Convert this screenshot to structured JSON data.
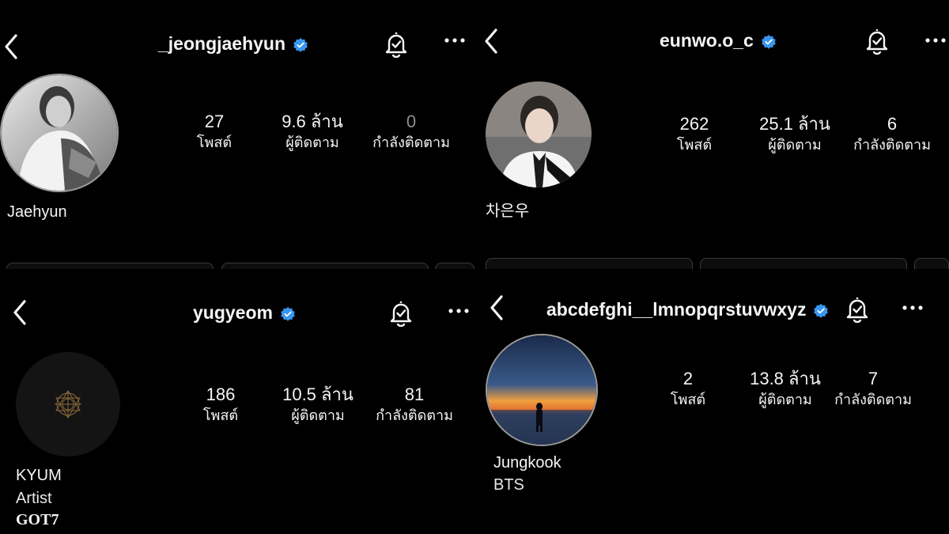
{
  "profiles": [
    {
      "username": "_jeongjaehyun",
      "verified": true,
      "display_name": "Jaehyun",
      "bio": [],
      "stats": [
        {
          "value": "27",
          "label": "โพสต์"
        },
        {
          "value": "9.6 ล้าน",
          "label": "ผู้ติดตาม"
        },
        {
          "value": "0",
          "label": "กำลังติดตาม"
        }
      ]
    },
    {
      "username": "eunwo.o_c",
      "verified": true,
      "display_name": "차은우",
      "bio": [],
      "stats": [
        {
          "value": "262",
          "label": "โพสต์"
        },
        {
          "value": "25.1 ล้าน",
          "label": "ผู้ติดตาม"
        },
        {
          "value": "6",
          "label": "กำลังติดตาม"
        }
      ]
    },
    {
      "username": "yugyeom",
      "verified": true,
      "display_name": "KYUM",
      "bio": [
        "Artist",
        "GOT7"
      ],
      "stats": [
        {
          "value": "186",
          "label": "โพสต์"
        },
        {
          "value": "10.5 ล้าน",
          "label": "ผู้ติดตาม"
        },
        {
          "value": "81",
          "label": "กำลังติดตาม"
        }
      ]
    },
    {
      "username": "abcdefghi__lmnopqrstuvwxyz",
      "verified": true,
      "display_name": "Jungkook",
      "bio": [
        "BTS"
      ],
      "stats": [
        {
          "value": "2",
          "label": "โพสต์"
        },
        {
          "value": "13.8 ล้าน",
          "label": "ผู้ติดตาม"
        },
        {
          "value": "7",
          "label": "กำลังติดตาม"
        }
      ]
    }
  ],
  "icons": {
    "back": "chevron-left-icon",
    "notify": "bell-check-icon",
    "more": "more-horizontal-icon",
    "verified": "verified-badge-icon"
  },
  "colors": {
    "background": "#000000",
    "text": "#f5f5f5",
    "verified": "#3897f0",
    "muted": "#8e8e8e"
  }
}
